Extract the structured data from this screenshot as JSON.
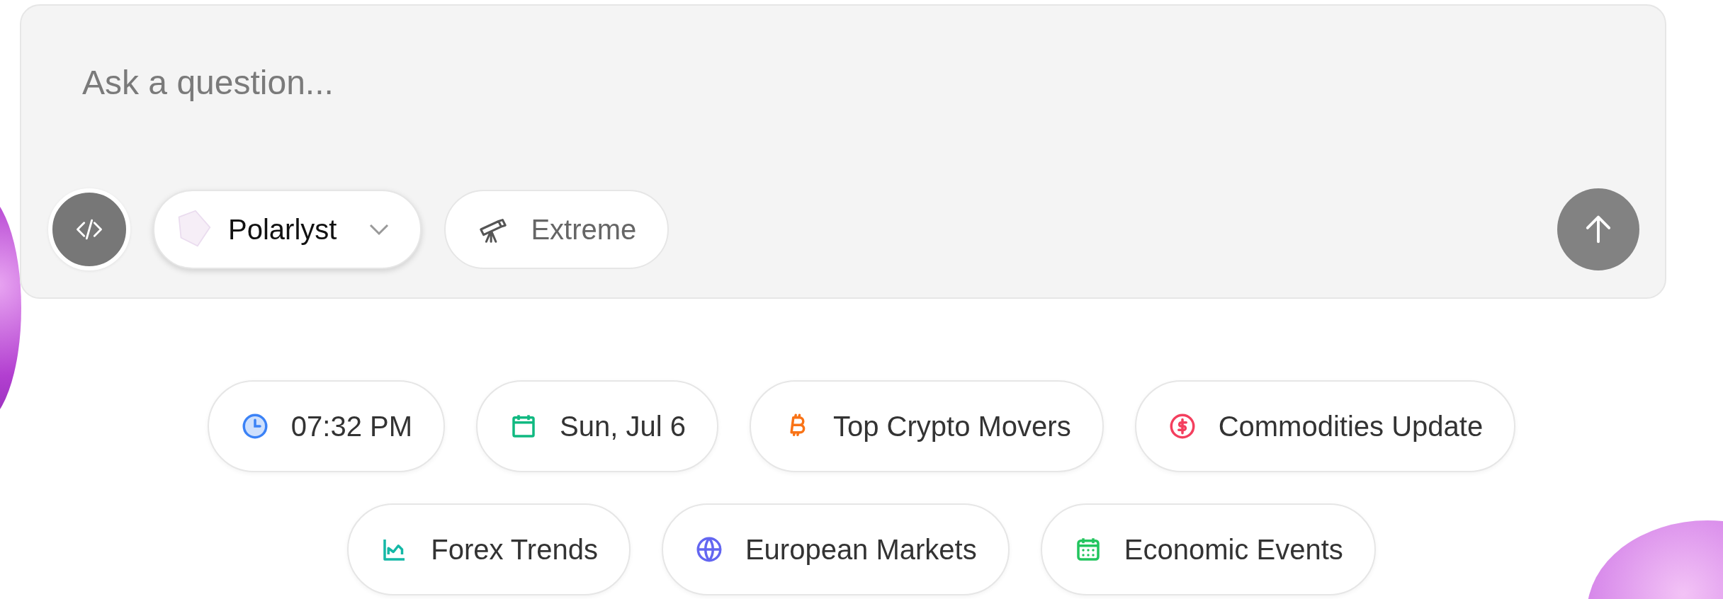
{
  "composer": {
    "placeholder": "Ask a question...",
    "model": {
      "label": "Polarlyst"
    },
    "mode": {
      "label": "Extreme"
    }
  },
  "suggestion_rows": [
    [
      {
        "label": "07:32 PM",
        "kind": "clock",
        "color": "#3b82f6"
      },
      {
        "label": "Sun, Jul 6",
        "kind": "calendar",
        "color": "#10b981"
      },
      {
        "label": "Top Crypto Movers",
        "kind": "bitcoin",
        "color": "#f97316"
      },
      {
        "label": "Commodities Update",
        "kind": "dollar",
        "color": "#f43f5e"
      }
    ],
    [
      {
        "label": "Forex Trends",
        "kind": "chart",
        "color": "#14b8a6"
      },
      {
        "label": "European Markets",
        "kind": "globe",
        "color": "#6366f1"
      },
      {
        "label": "Economic Events",
        "kind": "calendar-grid",
        "color": "#22c55e"
      }
    ]
  ]
}
